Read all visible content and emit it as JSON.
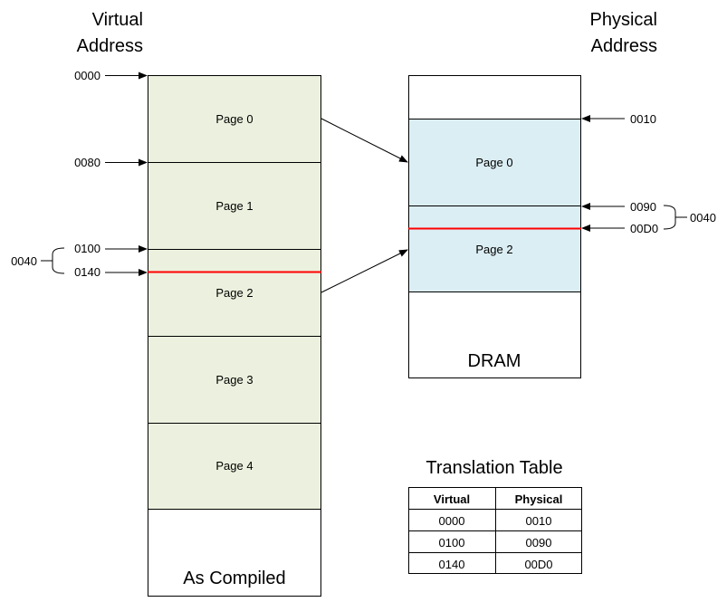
{
  "virtual": {
    "title_line1": "Virtual",
    "title_line2": "Address",
    "caption": "As Compiled",
    "pages": [
      "Page 0",
      "Page 1",
      "Page 2",
      "Page 3",
      "Page 4"
    ],
    "addresses": [
      "0000",
      "0080",
      "0100",
      "0140"
    ],
    "offset_label": "0040",
    "fill_color": "#EBF1DE"
  },
  "physical": {
    "title_line1": "Physical",
    "title_line2": "Address",
    "caption": "DRAM",
    "pages": [
      "Page 0",
      "Page 2"
    ],
    "addresses": [
      "0010",
      "0090",
      "00D0"
    ],
    "offset_label": "0040",
    "fill_color": "#DBEEF4"
  },
  "highlight_color": "#FF0000",
  "table": {
    "title": "Translation Table",
    "headers": [
      "Virtual",
      "Physical"
    ],
    "rows": [
      [
        "0000",
        "0010"
      ],
      [
        "0100",
        "0090"
      ],
      [
        "0140",
        "00D0"
      ]
    ]
  }
}
